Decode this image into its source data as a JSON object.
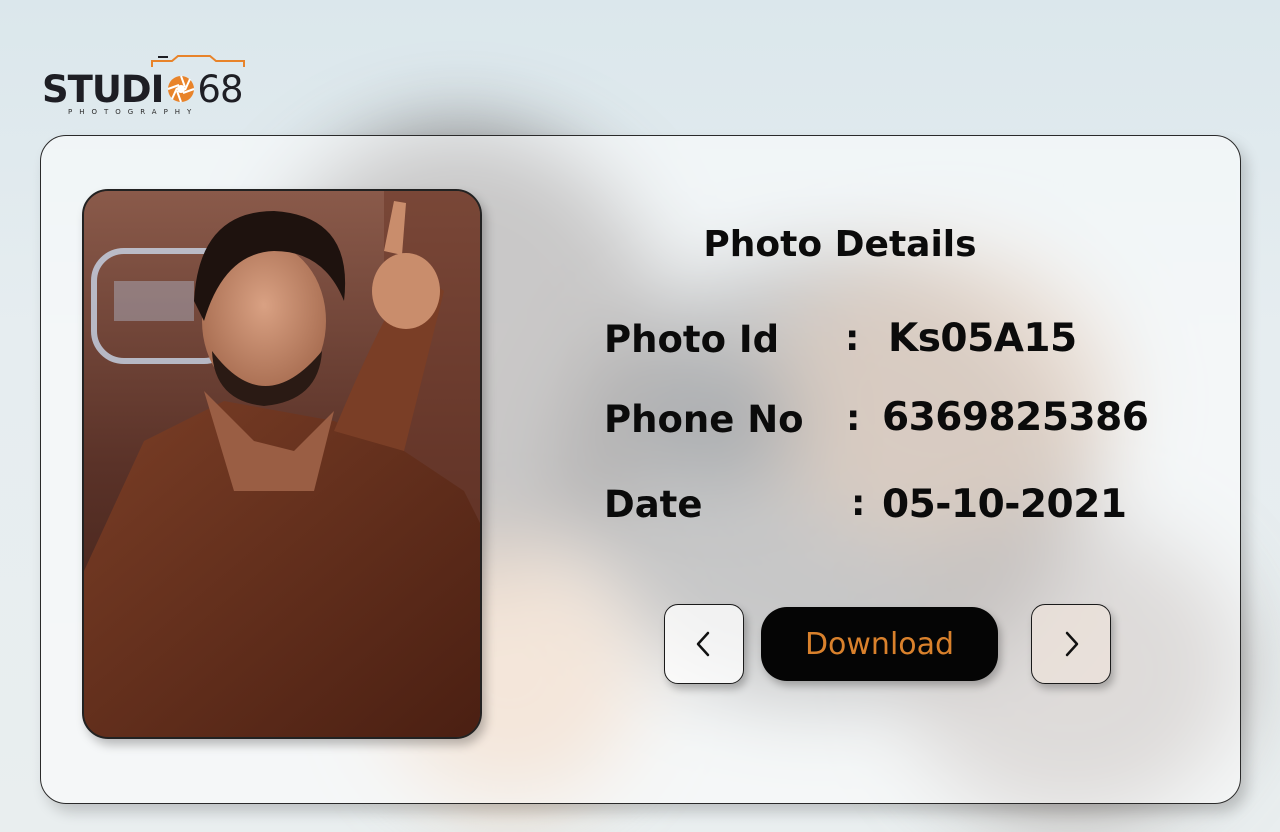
{
  "brand": {
    "name_prefix": "STUDI",
    "name_number": "68",
    "tagline": "PHOTOGRAPHY",
    "accent_color": "#e8832a"
  },
  "photo": {
    "alt": "Selected photo"
  },
  "details": {
    "title": "Photo Details",
    "rows": [
      {
        "label": "Photo Id",
        "separator": ":",
        "value": "Ks05A15"
      },
      {
        "label": "Phone No",
        "separator": ":",
        "value": "6369825386"
      },
      {
        "label": "Date",
        "separator": ":",
        "value": "05-10-2021"
      }
    ]
  },
  "actions": {
    "prev_icon": "chevron-left-icon",
    "download_label": "Download",
    "next_icon": "chevron-right-icon",
    "download_text_color": "#d9812c"
  }
}
